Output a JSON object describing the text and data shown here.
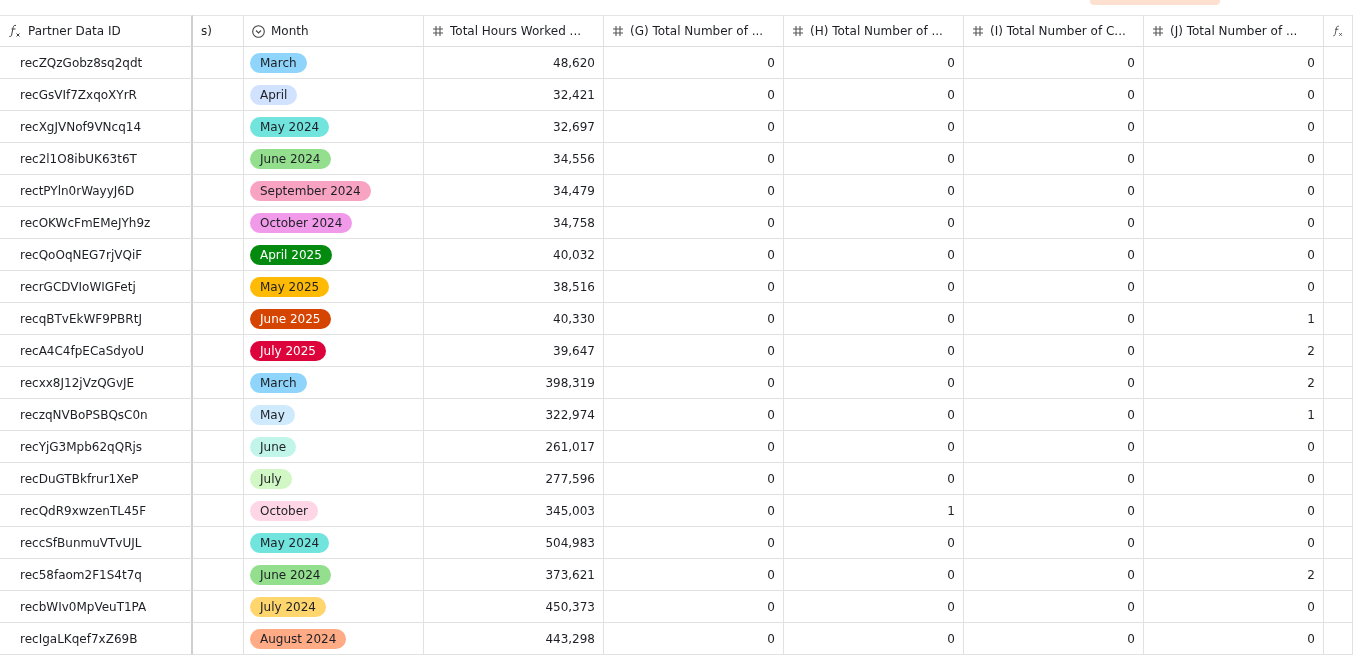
{
  "columns": [
    {
      "label": "Partner Data ID",
      "kind": "formula"
    },
    {
      "label": "s)",
      "kind": "text"
    },
    {
      "label": "Month",
      "kind": "select"
    },
    {
      "label": "Total Hours Worked ...",
      "kind": "number"
    },
    {
      "label": "(G) Total Number of ...",
      "kind": "number"
    },
    {
      "label": "(H) Total Number of ...",
      "kind": "number"
    },
    {
      "label": "(I) Total Number of C...",
      "kind": "number"
    },
    {
      "label": "(J) Total Number of ...",
      "kind": "number"
    },
    {
      "kind": "formula"
    }
  ],
  "rows": [
    {
      "id": "recZQzGobz8sq2qdt",
      "month": {
        "label": "March",
        "color": "#8fd5fb"
      },
      "values": [
        "48,620",
        "0",
        "0",
        "0",
        "0"
      ]
    },
    {
      "id": "recGsVIf7ZxqoXYrR",
      "month": {
        "label": "April",
        "color": "#d1e2ff"
      },
      "values": [
        "32,421",
        "0",
        "0",
        "0",
        "0"
      ]
    },
    {
      "id": "recXgJVNof9VNcq14",
      "month": {
        "label": "May 2024",
        "color": "#72e4de"
      },
      "values": [
        "32,697",
        "0",
        "0",
        "0",
        "0"
      ]
    },
    {
      "id": "rec2l1O8ibUK63t6T",
      "month": {
        "label": "June 2024",
        "color": "#93df8d"
      },
      "values": [
        "34,556",
        "0",
        "0",
        "0",
        "0"
      ]
    },
    {
      "id": "rectPYln0rWayyJ6D",
      "month": {
        "label": "September 2024",
        "color": "#f9a3c3"
      },
      "values": [
        "34,479",
        "0",
        "0",
        "0",
        "0"
      ]
    },
    {
      "id": "recOKWcFmEMeJYh9z",
      "month": {
        "label": "October 2024",
        "color": "#f09ae9"
      },
      "values": [
        "34,758",
        "0",
        "0",
        "0",
        "0"
      ]
    },
    {
      "id": "recQoOqNEG7rjVQiF",
      "month": {
        "label": "April 2025",
        "color": "#048a0e"
      },
      "values": [
        "40,032",
        "0",
        "0",
        "0",
        "0"
      ]
    },
    {
      "id": "recrGCDVIoWIGFetj",
      "month": {
        "label": "May 2025",
        "color": "#ffba05"
      },
      "values": [
        "38,516",
        "0",
        "0",
        "0",
        "0"
      ]
    },
    {
      "id": "recqBTvEkWF9PBRtJ",
      "month": {
        "label": "June 2025",
        "color": "#d54401"
      },
      "values": [
        "40,330",
        "0",
        "0",
        "0",
        "1"
      ]
    },
    {
      "id": "recA4C4fpECaSdyoU",
      "month": {
        "label": "July 2025",
        "color": "#dc043b"
      },
      "values": [
        "39,647",
        "0",
        "0",
        "0",
        "2"
      ]
    },
    {
      "id": "recxx8J12jVzQGvJE",
      "month": {
        "label": "March",
        "color": "#8fd5fb"
      },
      "values": [
        "398,319",
        "0",
        "0",
        "0",
        "2"
      ]
    },
    {
      "id": "reczqNVBoPSBQsC0n",
      "month": {
        "label": "May",
        "color": "#cfe9fd"
      },
      "values": [
        "322,974",
        "0",
        "0",
        "0",
        "1"
      ]
    },
    {
      "id": "recYjG3Mpb62qQRjs",
      "month": {
        "label": "June",
        "color": "#c2f5ea"
      },
      "values": [
        "261,017",
        "0",
        "0",
        "0",
        "0"
      ]
    },
    {
      "id": "recDuGTBkfrur1XeP",
      "month": {
        "label": "July",
        "color": "#d1f7c4"
      },
      "values": [
        "277,596",
        "0",
        "0",
        "0",
        "0"
      ]
    },
    {
      "id": "recQdR9xwzenTL45F",
      "month": {
        "label": "October",
        "color": "#ffd6e6"
      },
      "values": [
        "345,003",
        "0",
        "1",
        "0",
        "0"
      ]
    },
    {
      "id": "reccSfBunmuVTvUJL",
      "month": {
        "label": "May 2024",
        "color": "#72e4de"
      },
      "values": [
        "504,983",
        "0",
        "0",
        "0",
        "0"
      ]
    },
    {
      "id": "rec58faom2F1S4t7q",
      "month": {
        "label": "June 2024",
        "color": "#93df8d"
      },
      "values": [
        "373,621",
        "0",
        "0",
        "0",
        "2"
      ]
    },
    {
      "id": "recbWIv0MpVeuT1PA",
      "month": {
        "label": "July 2024",
        "color": "#ffd66e"
      },
      "values": [
        "450,373",
        "0",
        "0",
        "0",
        "0"
      ]
    },
    {
      "id": "recIgaLKqef7xZ69B",
      "month": {
        "label": "August 2024",
        "color": "#ffab85"
      },
      "values": [
        "443,298",
        "0",
        "0",
        "0",
        "0"
      ]
    }
  ]
}
